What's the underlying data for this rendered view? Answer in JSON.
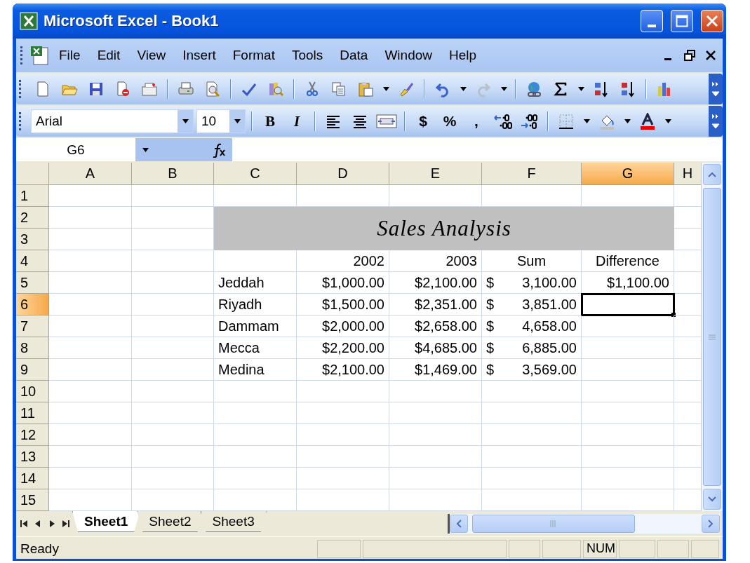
{
  "window": {
    "title": "Microsoft Excel - Book1"
  },
  "menu": [
    "File",
    "Edit",
    "View",
    "Insert",
    "Format",
    "Tools",
    "Data",
    "Window",
    "Help"
  ],
  "formatting_toolbar": {
    "font": "Arial",
    "size": "10",
    "buttons": [
      "B",
      "I",
      "$",
      "%",
      ","
    ]
  },
  "formula_bar": {
    "name_box": "G6"
  },
  "columns": [
    {
      "label": "A",
      "selected": false
    },
    {
      "label": "B",
      "selected": false
    },
    {
      "label": "C",
      "selected": false
    },
    {
      "label": "D",
      "selected": false
    },
    {
      "label": "E",
      "selected": false
    },
    {
      "label": "F",
      "selected": false
    },
    {
      "label": "G",
      "selected": true
    },
    {
      "label": "H",
      "selected": false
    }
  ],
  "title_band": {
    "text": "Sales Analysis"
  },
  "rows": [
    {
      "label": "1",
      "selected": false
    },
    {
      "label": "2",
      "selected": false
    },
    {
      "label": "3",
      "selected": false
    },
    {
      "label": "4",
      "selected": false,
      "cells": [
        null,
        null,
        null,
        {
          "kind": "number",
          "text": "2002"
        },
        {
          "kind": "number",
          "text": "2003"
        },
        {
          "kind": "heading",
          "text": "Sum"
        },
        {
          "kind": "heading",
          "text": "Difference"
        },
        null
      ]
    },
    {
      "label": "5",
      "selected": false,
      "cells": [
        null,
        null,
        {
          "kind": "text",
          "text": "Jeddah"
        },
        {
          "kind": "number",
          "text": "$1,000.00"
        },
        {
          "kind": "number",
          "text": "$2,100.00"
        },
        {
          "kind": "accounting",
          "symbol": "$",
          "text": "3,100.00"
        },
        {
          "kind": "number",
          "text": "$1,100.00"
        },
        null
      ]
    },
    {
      "label": "6",
      "selected": true,
      "cells": [
        null,
        null,
        {
          "kind": "text",
          "text": "Riyadh"
        },
        {
          "kind": "number",
          "text": "$1,500.00"
        },
        {
          "kind": "number",
          "text": "$2,351.00"
        },
        {
          "kind": "accounting",
          "symbol": "$",
          "text": "3,851.00"
        },
        null,
        null
      ]
    },
    {
      "label": "7",
      "selected": false,
      "cells": [
        null,
        null,
        {
          "kind": "text",
          "text": "Dammam"
        },
        {
          "kind": "number",
          "text": "$2,000.00"
        },
        {
          "kind": "number",
          "text": "$2,658.00"
        },
        {
          "kind": "accounting",
          "symbol": "$",
          "text": "4,658.00"
        },
        null,
        null
      ]
    },
    {
      "label": "8",
      "selected": false,
      "cells": [
        null,
        null,
        {
          "kind": "text",
          "text": "Mecca"
        },
        {
          "kind": "number",
          "text": "$2,200.00"
        },
        {
          "kind": "number",
          "text": "$4,685.00"
        },
        {
          "kind": "accounting",
          "symbol": "$",
          "text": "6,885.00"
        },
        null,
        null
      ]
    },
    {
      "label": "9",
      "selected": false,
      "cells": [
        null,
        null,
        {
          "kind": "text",
          "text": "Medina"
        },
        {
          "kind": "number",
          "text": "$2,100.00"
        },
        {
          "kind": "number",
          "text": "$1,469.00"
        },
        {
          "kind": "accounting",
          "symbol": "$",
          "text": "3,569.00"
        },
        null,
        null
      ]
    },
    {
      "label": "10",
      "selected": false
    },
    {
      "label": "11",
      "selected": false
    },
    {
      "label": "12",
      "selected": false
    },
    {
      "label": "13",
      "selected": false
    },
    {
      "label": "14",
      "selected": false
    },
    {
      "label": "15",
      "selected": false
    }
  ],
  "sheet_tabs": [
    {
      "label": "Sheet1",
      "selected": true
    },
    {
      "label": "Sheet2",
      "selected": false
    },
    {
      "label": "Sheet3",
      "selected": false
    }
  ],
  "status_bar": {
    "text": "Ready",
    "indicator": "NUM"
  }
}
